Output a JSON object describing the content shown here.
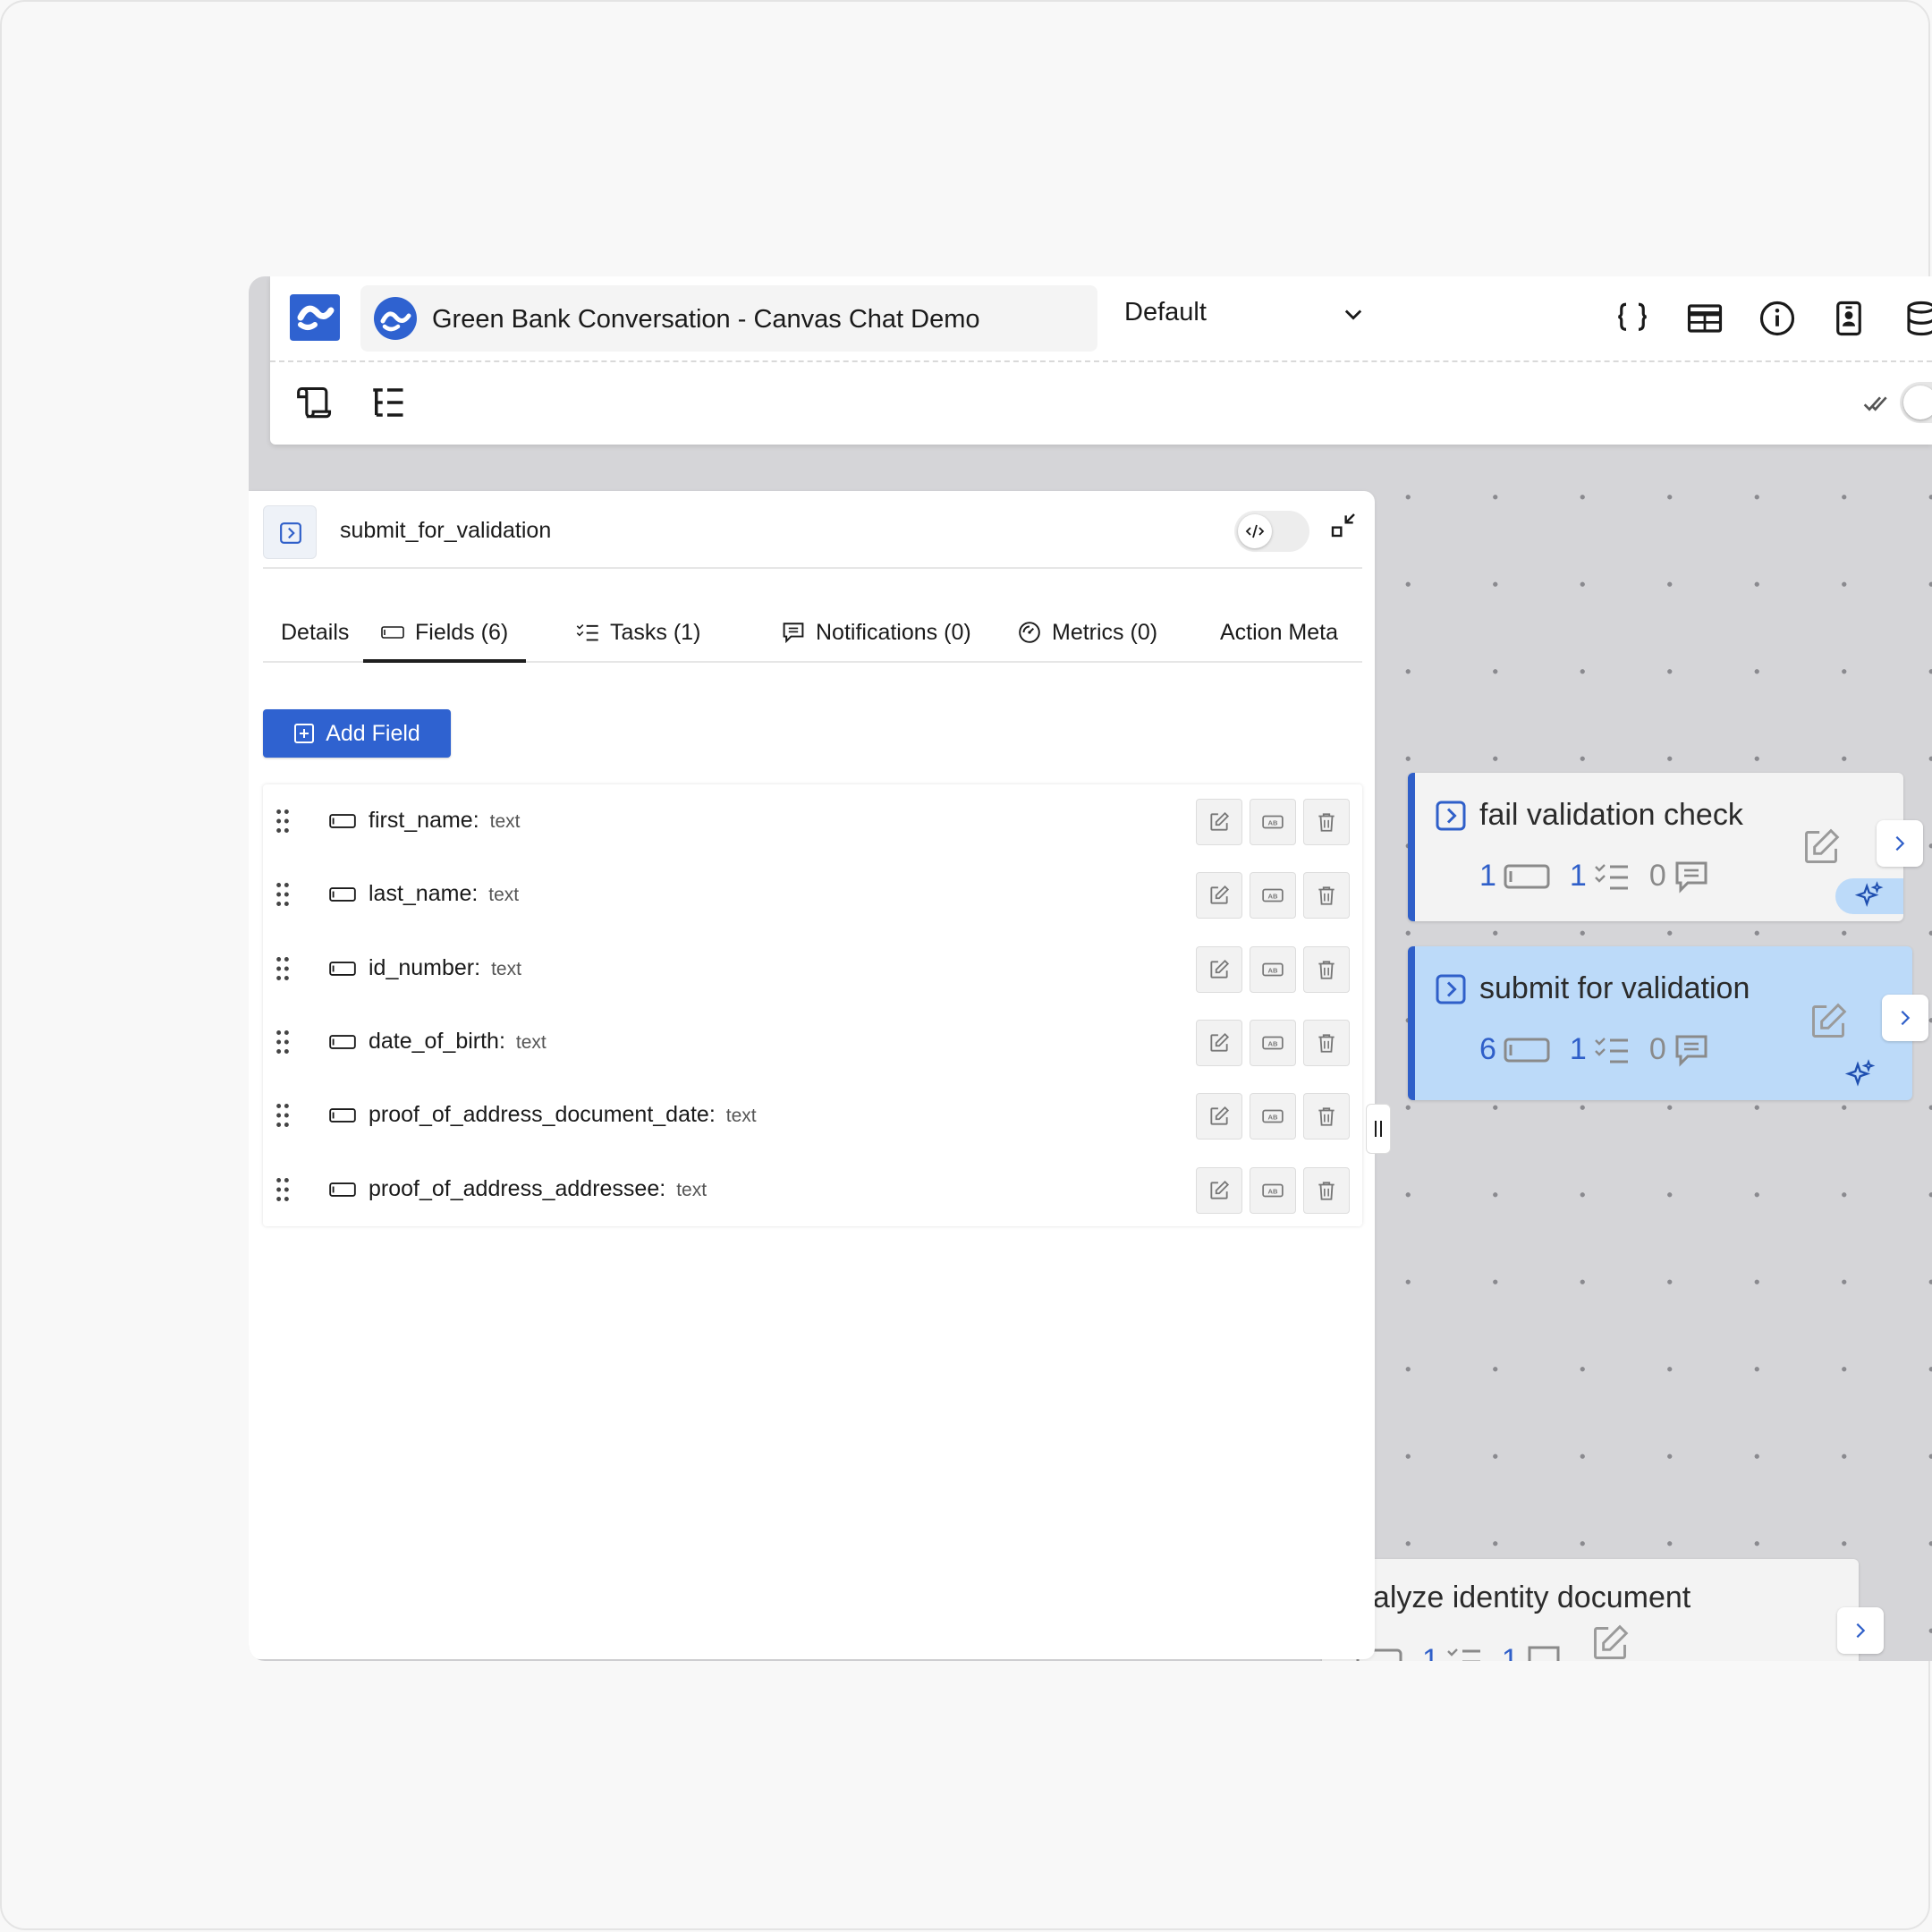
{
  "app": {
    "title": "Green Bank Conversation - Canvas Chat Demo",
    "environment": "Default",
    "brand_color": "#2f62d0"
  },
  "header_icons": [
    "braces-icon",
    "table-icon",
    "info-icon",
    "id-card-icon",
    "database-icon"
  ],
  "toolbar_icons": [
    "scroll-icon",
    "tree-list-icon",
    "double-check-icon"
  ],
  "panel": {
    "title": "submit_for_validation",
    "tabs": [
      {
        "label": "Details",
        "icon": ""
      },
      {
        "label": "Fields (6)",
        "icon": "field-icon",
        "active": true
      },
      {
        "label": "Tasks (1)",
        "icon": "checklist-icon"
      },
      {
        "label": "Notifications (0)",
        "icon": "message-icon"
      },
      {
        "label": "Metrics (0)",
        "icon": "gauge-icon"
      },
      {
        "label": "Action Meta",
        "icon": ""
      }
    ],
    "add_field_label": "Add Field",
    "fields": [
      {
        "name": "first_name:",
        "type": "text"
      },
      {
        "name": "last_name:",
        "type": "text"
      },
      {
        "name": "id_number:",
        "type": "text"
      },
      {
        "name": "date_of_birth:",
        "type": "text"
      },
      {
        "name": "proof_of_address_document_date:",
        "type": "text"
      },
      {
        "name": "proof_of_address_addressee:",
        "type": "text"
      }
    ]
  },
  "nodes": [
    {
      "title": "fail validation check",
      "fields": "1",
      "tasks": "1",
      "notifications": "0"
    },
    {
      "title": "submit for validation",
      "fields": "6",
      "tasks": "1",
      "notifications": "0"
    },
    {
      "title": "nalyze identity document",
      "fields": "",
      "tasks": "1",
      "notifications": "1"
    }
  ]
}
